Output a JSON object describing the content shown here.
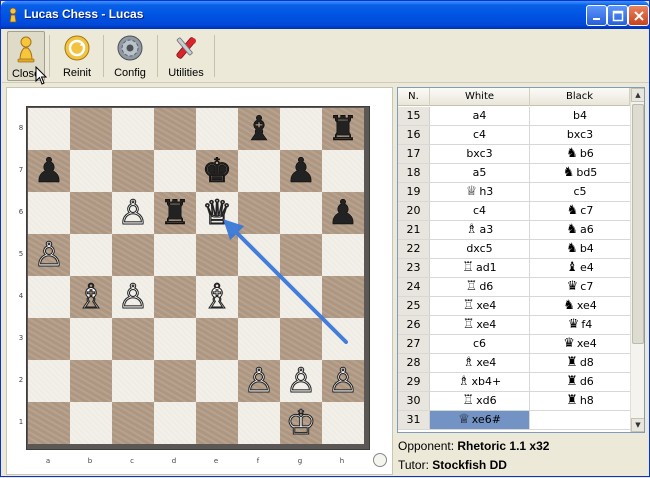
{
  "window": {
    "title": "Lucas Chess - Lucas",
    "colors": {
      "titlebar": "#0054e3",
      "board_light": "#f3f0ea",
      "board_dark": "#b39c86",
      "arrow": "#3a78d8",
      "selection": "#7393c5"
    }
  },
  "toolbar": {
    "buttons": [
      {
        "label": "Close",
        "icon": "close-pawn-icon"
      },
      {
        "label": "Reinit",
        "icon": "reinit-icon"
      },
      {
        "label": "Config",
        "icon": "config-gear-icon"
      },
      {
        "label": "Utilities",
        "icon": "utilities-tools-icon"
      }
    ]
  },
  "board": {
    "ranks": [
      "8",
      "7",
      "6",
      "5",
      "4",
      "3",
      "2",
      "1"
    ],
    "files": [
      "a",
      "b",
      "c",
      "d",
      "e",
      "f",
      "g",
      "h"
    ],
    "pieces": [
      {
        "square": "f8",
        "glyph": "♝",
        "color": "black",
        "name": "black-bishop"
      },
      {
        "square": "h8",
        "glyph": "♜",
        "color": "black",
        "name": "black-rook"
      },
      {
        "square": "a7",
        "glyph": "♟",
        "color": "black",
        "name": "black-pawn"
      },
      {
        "square": "e7",
        "glyph": "♚",
        "color": "black",
        "name": "black-king"
      },
      {
        "square": "g7",
        "glyph": "♟",
        "color": "black",
        "name": "black-pawn"
      },
      {
        "square": "c6",
        "glyph": "♙",
        "color": "white",
        "name": "white-pawn"
      },
      {
        "square": "d6",
        "glyph": "♜",
        "color": "black",
        "name": "black-rook"
      },
      {
        "square": "e6",
        "glyph": "♕",
        "color": "white",
        "name": "white-queen"
      },
      {
        "square": "h6",
        "glyph": "♟",
        "color": "black",
        "name": "black-pawn"
      },
      {
        "square": "a5",
        "glyph": "♙",
        "color": "white",
        "name": "white-pawn"
      },
      {
        "square": "b4",
        "glyph": "♗",
        "color": "white",
        "name": "white-bishop"
      },
      {
        "square": "c4",
        "glyph": "♙",
        "color": "white",
        "name": "white-pawn"
      },
      {
        "square": "e4",
        "glyph": "♗",
        "color": "white",
        "name": "white-bishop"
      },
      {
        "square": "f2",
        "glyph": "♙",
        "color": "white",
        "name": "white-pawn"
      },
      {
        "square": "g2",
        "glyph": "♙",
        "color": "white",
        "name": "white-pawn"
      },
      {
        "square": "h2",
        "glyph": "♙",
        "color": "white",
        "name": "white-pawn"
      },
      {
        "square": "g1",
        "glyph": "♔",
        "color": "white",
        "name": "white-king"
      }
    ],
    "arrow": {
      "from": "h3",
      "to": "e6"
    }
  },
  "moves": {
    "headers": {
      "num": "N.",
      "white": "White",
      "black": "Black"
    },
    "rows": [
      {
        "n": "15",
        "white": "a4",
        "white_fig": "",
        "black": "b4",
        "black_fig": ""
      },
      {
        "n": "16",
        "white": "c4",
        "white_fig": "",
        "black": "bxc3",
        "black_fig": ""
      },
      {
        "n": "17",
        "white": "bxc3",
        "white_fig": "",
        "black": "b6",
        "black_fig": "♞"
      },
      {
        "n": "18",
        "white": "a5",
        "white_fig": "",
        "black": "bd5",
        "black_fig": "♞"
      },
      {
        "n": "19",
        "white": "h3",
        "white_fig": "♕",
        "black": "c5",
        "black_fig": ""
      },
      {
        "n": "20",
        "white": "c4",
        "white_fig": "",
        "black": "c7",
        "black_fig": "♞"
      },
      {
        "n": "21",
        "white": "a3",
        "white_fig": "♗",
        "black": "a6",
        "black_fig": "♞"
      },
      {
        "n": "22",
        "white": "dxc5",
        "white_fig": "",
        "black": "b4",
        "black_fig": "♞"
      },
      {
        "n": "23",
        "white": "ad1",
        "white_fig": "♖",
        "black": "e4",
        "black_fig": "♝"
      },
      {
        "n": "24",
        "white": "d6",
        "white_fig": "♖",
        "black": "c7",
        "black_fig": "♛"
      },
      {
        "n": "25",
        "white": "xe4",
        "white_fig": "♖",
        "black": "xe4",
        "black_fig": "♞"
      },
      {
        "n": "26",
        "white": "xe4",
        "white_fig": "♖",
        "black": "f4",
        "black_fig": "♛"
      },
      {
        "n": "27",
        "white": "c6",
        "white_fig": "",
        "black": "xe4",
        "black_fig": "♛"
      },
      {
        "n": "28",
        "white": "xe4",
        "white_fig": "♗",
        "black": "d8",
        "black_fig": "♜"
      },
      {
        "n": "29",
        "white": "xb4+",
        "white_fig": "♗",
        "black": "d6",
        "black_fig": "♜"
      },
      {
        "n": "30",
        "white": "xd6",
        "white_fig": "♖",
        "black": "h8",
        "black_fig": "♜"
      },
      {
        "n": "31",
        "white": "xe6#",
        "white_fig": "♕",
        "black": "",
        "black_fig": "",
        "selected": true
      }
    ]
  },
  "info": {
    "opponent_label": "Opponent:",
    "opponent_value": "Rhetoric 1.1 x32",
    "tutor_label": "Tutor:",
    "tutor_value": "Stockfish DD"
  }
}
